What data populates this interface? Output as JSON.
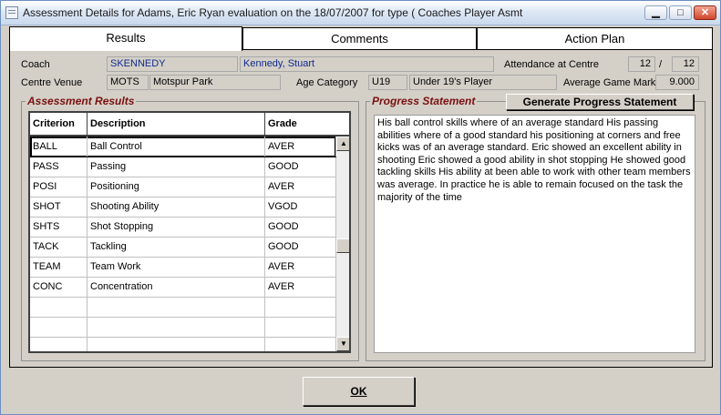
{
  "window": {
    "title": "Assessment Details for Adams, Eric Ryan evaluation on the 18/07/2007 for type ( Coaches Player Asmt",
    "controls": {
      "minimize": "▁",
      "maximize": "□",
      "close": "✕"
    }
  },
  "tabs": [
    {
      "label": "Results",
      "active": true
    },
    {
      "label": "Comments",
      "active": false
    },
    {
      "label": "Action Plan",
      "active": false
    }
  ],
  "header": {
    "coach_label": "Coach",
    "coach_code": "SKENNEDY",
    "coach_name": "Kennedy, Stuart",
    "attendance_label": "Attendance at Centre",
    "attendance_attended": "12",
    "attendance_sep": "/",
    "attendance_total": "12",
    "venue_label": "Centre Venue",
    "venue_code": "MOTS",
    "venue_name": "Motspur Park",
    "age_label": "Age Category",
    "age_code": "U19",
    "age_name": "Under 19's Player",
    "mark_label": "Average Game Mark",
    "mark_value": "9.000"
  },
  "assessment": {
    "group_title": "Assessment Results",
    "columns": [
      "Criterion",
      "Description",
      "Grade"
    ],
    "rows": [
      {
        "criterion": "BALL",
        "description": "Ball Control",
        "grade": "AVER"
      },
      {
        "criterion": "PASS",
        "description": "Passing",
        "grade": "GOOD"
      },
      {
        "criterion": "POSI",
        "description": "Positioning",
        "grade": "AVER"
      },
      {
        "criterion": "SHOT",
        "description": "Shooting Ability",
        "grade": "VGOD"
      },
      {
        "criterion": "SHTS",
        "description": "Shot Stopping",
        "grade": "GOOD"
      },
      {
        "criterion": "TACK",
        "description": "Tackling",
        "grade": "GOOD"
      },
      {
        "criterion": "TEAM",
        "description": "Team Work",
        "grade": "AVER"
      },
      {
        "criterion": "CONC",
        "description": "Concentration",
        "grade": "AVER"
      },
      {
        "criterion": "",
        "description": "",
        "grade": ""
      },
      {
        "criterion": "",
        "description": "",
        "grade": ""
      },
      {
        "criterion": "",
        "description": "",
        "grade": ""
      }
    ],
    "scroll_up": "▲",
    "scroll_down": "▼"
  },
  "progress": {
    "group_title": "Progress Statement",
    "generate_button": "Generate Progress Statement",
    "text": "His ball control skills where of an average standard His passing abilities where of a good standard his positioning at corners and free kicks was of an average standard. Eric showed an excellent ability in shooting Eric showed a good ability in shot stopping He showed good tackling skills His ability at been able to work with other team members was average. In practice he is able to remain focused on the task the majority of the time"
  },
  "footer": {
    "ok_label": "OK"
  }
}
